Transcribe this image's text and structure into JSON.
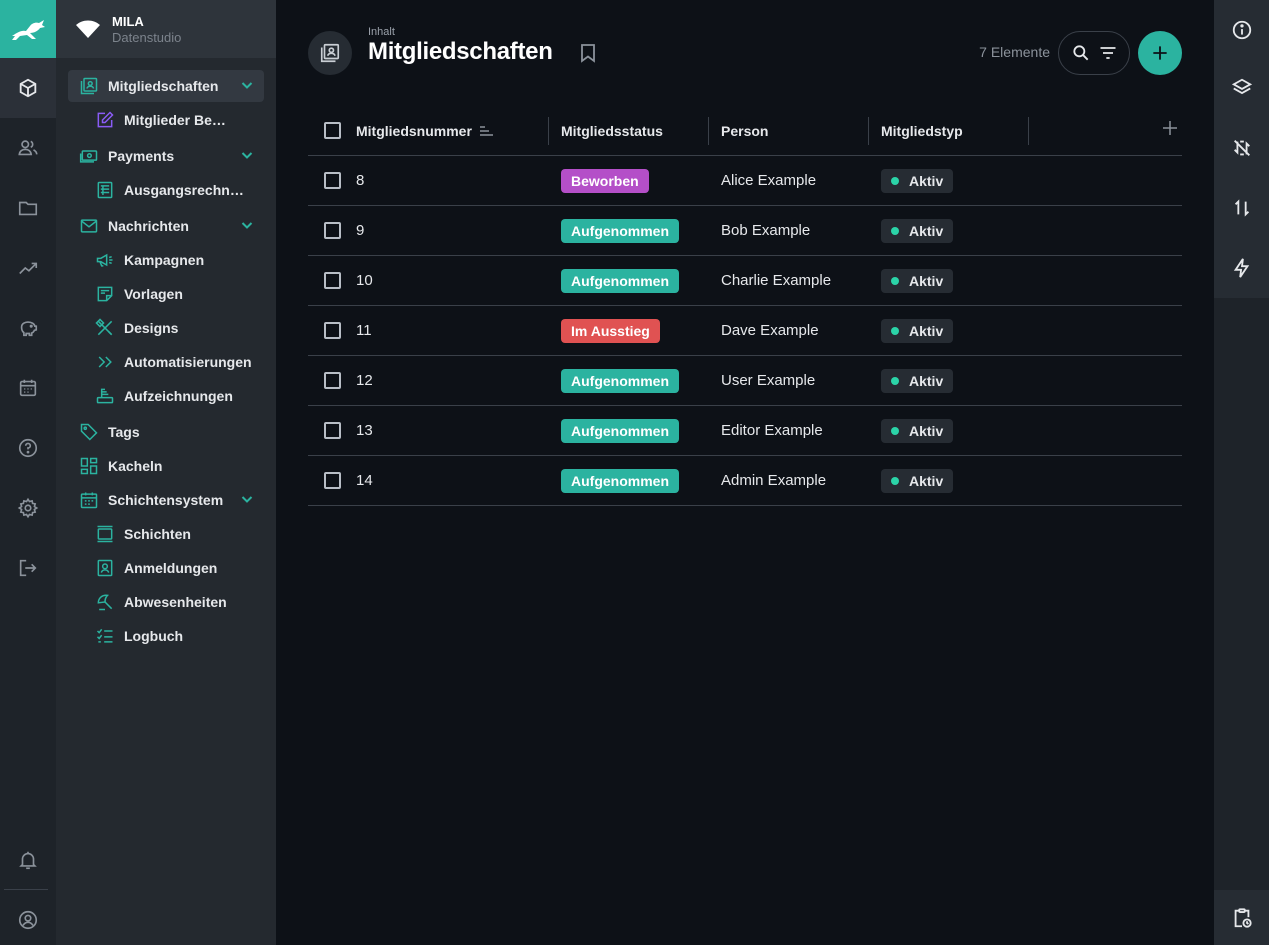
{
  "workspace": {
    "name": "MILA",
    "subtitle": "Datenstudio"
  },
  "colors": {
    "accent": "#2bb3a0",
    "beworben": "#b44fc8",
    "aufgenommen": "#2bb3a0",
    "im_ausstieg": "#e05252",
    "aktiv_dot": "#2bd4a8"
  },
  "rail": {
    "icons": [
      "cube-icon",
      "users-icon",
      "folder-icon",
      "trend-icon",
      "piggy-bank-icon",
      "calendar-icon",
      "help-icon",
      "settings-icon",
      "logout-icon",
      "bell-icon",
      "account-icon"
    ]
  },
  "sidebar": {
    "items": [
      {
        "label": "Mitgliedschaften",
        "icon": "membership-icon",
        "level": 0,
        "expandable": true,
        "active": true
      },
      {
        "label": "Mitglieder Bewerbungen",
        "icon": "edit-icon",
        "level": 1
      },
      {
        "label": "Payments",
        "icon": "money-icon",
        "level": 0,
        "expandable": true
      },
      {
        "label": "Ausgangsrechnungen",
        "icon": "invoice-icon",
        "level": 1
      },
      {
        "label": "Nachrichten",
        "icon": "mail-icon",
        "level": 0,
        "expandable": true
      },
      {
        "label": "Kampagnen",
        "icon": "megaphone-icon",
        "level": 1
      },
      {
        "label": "Vorlagen",
        "icon": "template-icon",
        "level": 1
      },
      {
        "label": "Designs",
        "icon": "design-icon",
        "level": 1
      },
      {
        "label": "Automatisierungen",
        "icon": "automation-icon",
        "level": 1
      },
      {
        "label": "Aufzeichnungen",
        "icon": "recording-icon",
        "level": 1
      },
      {
        "label": "Tags",
        "icon": "tag-icon",
        "level": 0
      },
      {
        "label": "Kacheln",
        "icon": "tiles-icon",
        "level": 0
      },
      {
        "label": "Schichtensystem",
        "icon": "calendar-grid-icon",
        "level": 0,
        "expandable": true
      },
      {
        "label": "Schichten",
        "icon": "shifts-icon",
        "level": 1
      },
      {
        "label": "Anmeldungen",
        "icon": "signup-icon",
        "level": 1
      },
      {
        "label": "Abwesenheiten",
        "icon": "absence-icon",
        "level": 1
      },
      {
        "label": "Logbuch",
        "icon": "logbook-icon",
        "level": 1
      }
    ]
  },
  "header": {
    "breadcrumb": "Inhalt",
    "title": "Mitgliedschaften",
    "count": "7 Elemente"
  },
  "table": {
    "columns": [
      "Mitgliedsnummer",
      "Mitgliedsstatus",
      "Person",
      "Mitgliedstyp"
    ],
    "rows": [
      {
        "number": "8",
        "status": "Beworben",
        "status_kind": "beworben",
        "person": "Alice Example",
        "type": "Aktiv"
      },
      {
        "number": "9",
        "status": "Aufgenommen",
        "status_kind": "aufgenommen",
        "person": "Bob Example",
        "type": "Aktiv"
      },
      {
        "number": "10",
        "status": "Aufgenommen",
        "status_kind": "aufgenommen",
        "person": "Charlie Example",
        "type": "Aktiv"
      },
      {
        "number": "11",
        "status": "Im Ausstieg",
        "status_kind": "im_ausstieg",
        "person": "Dave Example",
        "type": "Aktiv"
      },
      {
        "number": "12",
        "status": "Aufgenommen",
        "status_kind": "aufgenommen",
        "person": "User Example",
        "type": "Aktiv"
      },
      {
        "number": "13",
        "status": "Aufgenommen",
        "status_kind": "aufgenommen",
        "person": "Editor Example",
        "type": "Aktiv"
      },
      {
        "number": "14",
        "status": "Aufgenommen",
        "status_kind": "aufgenommen",
        "person": "Admin Example",
        "type": "Aktiv"
      }
    ]
  },
  "right_rail": {
    "icons": [
      "info-icon",
      "layers-icon",
      "sync-off-icon",
      "sort-arrows-icon",
      "bolt-icon",
      "clipboard-clock-icon"
    ]
  }
}
